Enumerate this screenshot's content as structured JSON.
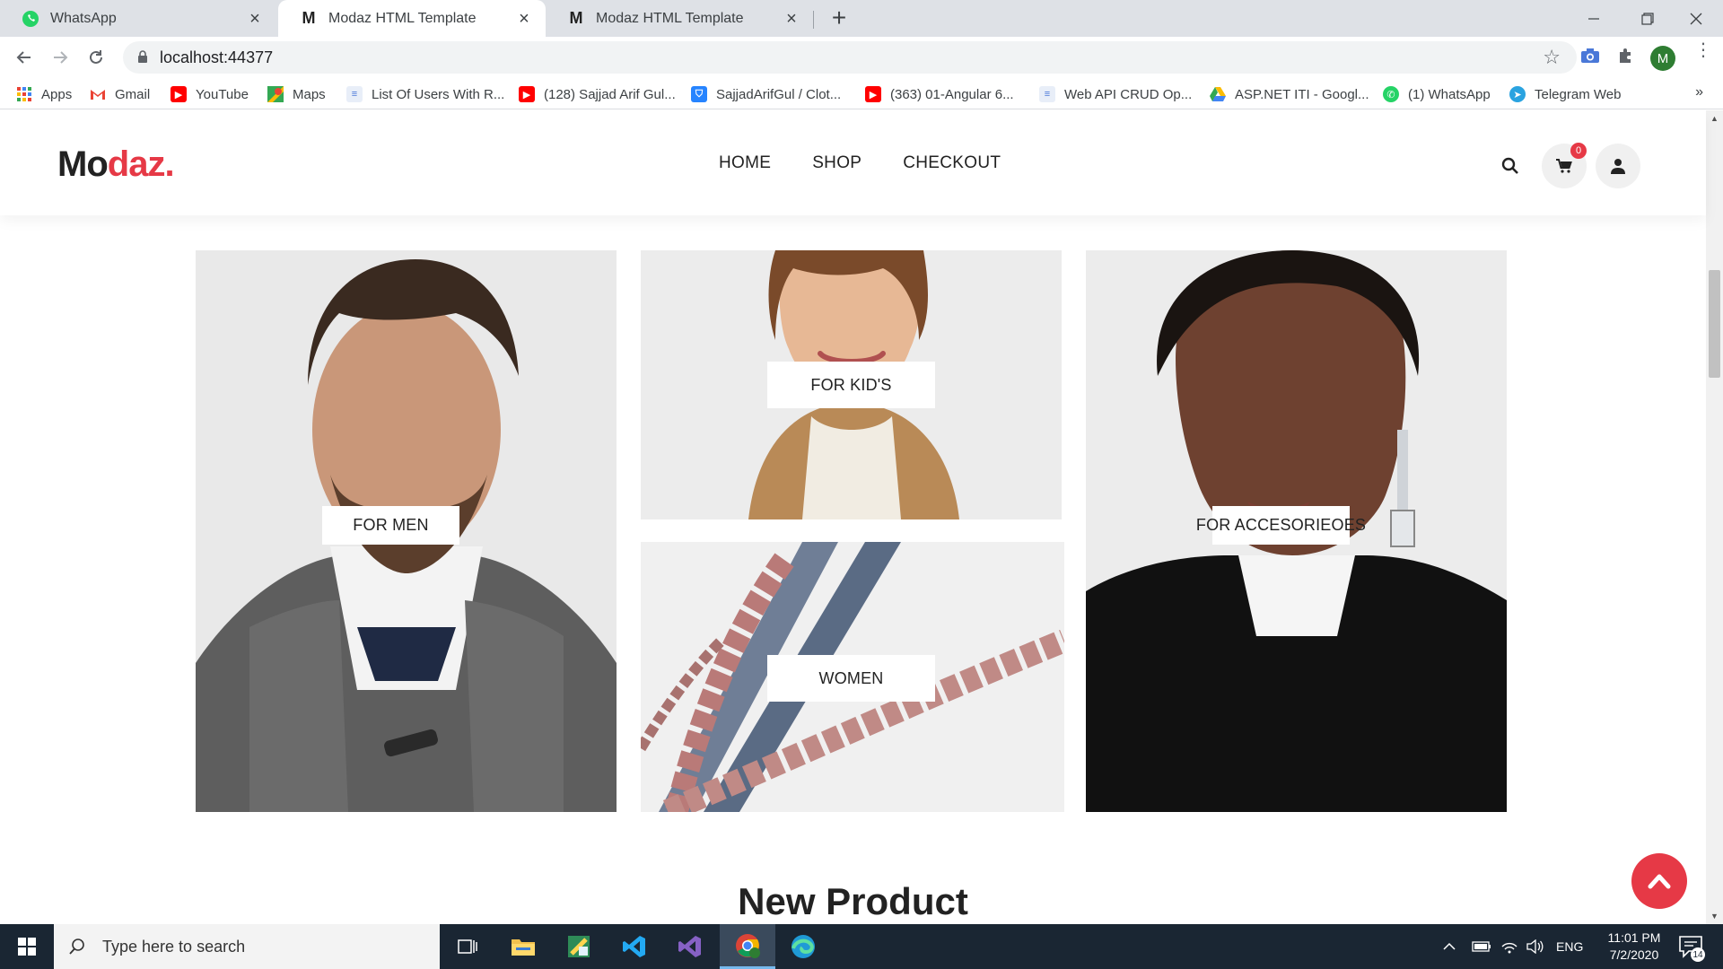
{
  "browser": {
    "tabs": [
      {
        "title": "WhatsApp",
        "favicon": "whatsapp-icon",
        "active": false
      },
      {
        "title": "Modaz HTML Template",
        "favicon": "modaz-m-icon",
        "active": true
      },
      {
        "title": "Modaz HTML Template",
        "favicon": "modaz-m-icon",
        "active": false
      }
    ],
    "url": "localhost:44377",
    "profile_initial": "M",
    "bookmarks": [
      {
        "label": "Apps",
        "icon": "apps-grid-icon"
      },
      {
        "label": "Gmail",
        "icon": "gmail-icon"
      },
      {
        "label": "YouTube",
        "icon": "youtube-icon"
      },
      {
        "label": "Maps",
        "icon": "maps-icon"
      },
      {
        "label": "List Of Users With R...",
        "icon": "page-icon"
      },
      {
        "label": "(128) Sajjad Arif Gul...",
        "icon": "youtube-icon"
      },
      {
        "label": "SajjadArifGul / Clot...",
        "icon": "bitbucket-icon"
      },
      {
        "label": "(363) 01-Angular 6...",
        "icon": "youtube-icon"
      },
      {
        "label": "Web API CRUD Op...",
        "icon": "page-icon"
      },
      {
        "label": "ASP.NET ITI - Googl...",
        "icon": "google-drive-icon"
      },
      {
        "label": "(1) WhatsApp",
        "icon": "whatsapp-icon"
      },
      {
        "label": "Telegram Web",
        "icon": "telegram-icon"
      }
    ],
    "bookmarks_more": "»"
  },
  "site": {
    "logo_main": "Mo",
    "logo_accent": "daz.",
    "nav": [
      "HOME",
      "SHOP",
      "CHECKOUT"
    ],
    "cart_count": "0",
    "banners": {
      "men": "FOR MEN",
      "kids": "FOR KID'S",
      "women": "WOMEN",
      "accessories": "FOR ACCESORIEOES"
    },
    "section_title": "New Product"
  },
  "taskbar": {
    "search_placeholder": "Type here to search",
    "language": "ENG",
    "time": "11:01 PM",
    "date": "7/2/2020",
    "notifications": "14"
  },
  "colors": {
    "accent": "#e63946",
    "taskbar": "#1a2633",
    "tabstrip": "#dee1e6"
  }
}
